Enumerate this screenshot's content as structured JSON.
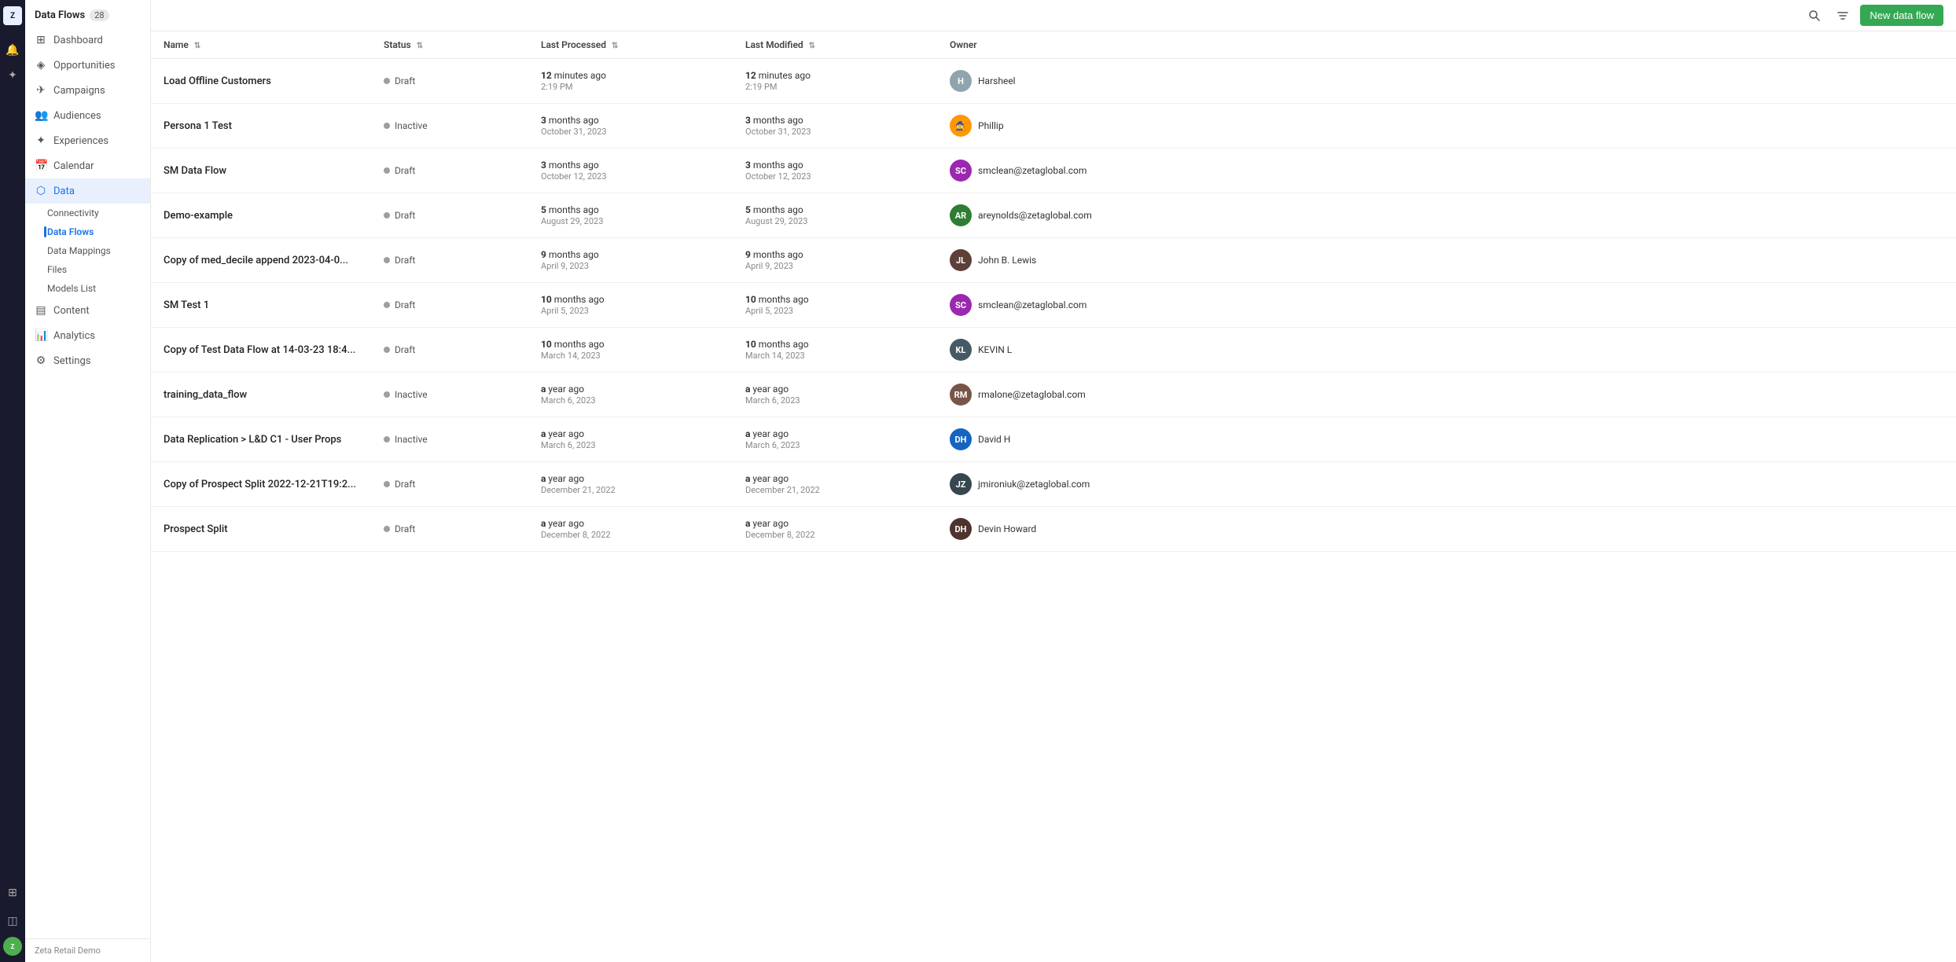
{
  "app": {
    "title": "Data Flows",
    "count": "28",
    "new_button": "New data flow",
    "org": "Zeta Retail Demo"
  },
  "iconbar": {
    "zeta_label": "ZETA"
  },
  "sidebar": {
    "items": [
      {
        "id": "dashboard",
        "label": "Dashboard",
        "icon": "⊞"
      },
      {
        "id": "opportunities",
        "label": "Opportunities",
        "icon": "◈"
      },
      {
        "id": "campaigns",
        "label": "Campaigns",
        "icon": "✈"
      },
      {
        "id": "audiences",
        "label": "Audiences",
        "icon": "👥"
      },
      {
        "id": "experiences",
        "label": "Experiences",
        "icon": "✦"
      },
      {
        "id": "calendar",
        "label": "Calendar",
        "icon": "📅"
      },
      {
        "id": "data",
        "label": "Data",
        "icon": "⬡",
        "active": true
      },
      {
        "id": "content",
        "label": "Content",
        "icon": "▤"
      },
      {
        "id": "analytics",
        "label": "Analytics",
        "icon": "📊"
      },
      {
        "id": "settings",
        "label": "Settings",
        "icon": "⚙"
      }
    ],
    "data_sub": [
      {
        "id": "connectivity",
        "label": "Connectivity"
      },
      {
        "id": "dataflows",
        "label": "Data Flows",
        "active": true
      },
      {
        "id": "datamappings",
        "label": "Data Mappings"
      },
      {
        "id": "files",
        "label": "Files"
      },
      {
        "id": "modelslist",
        "label": "Models List"
      }
    ]
  },
  "table": {
    "columns": [
      {
        "id": "name",
        "label": "Name"
      },
      {
        "id": "status",
        "label": "Status"
      },
      {
        "id": "last_processed",
        "label": "Last Processed"
      },
      {
        "id": "last_modified",
        "label": "Last Modified"
      },
      {
        "id": "owner",
        "label": "Owner"
      }
    ],
    "rows": [
      {
        "name": "Load Offline Customers",
        "status": "Draft",
        "status_type": "draft",
        "processed_ago": "12 minutes ago",
        "processed_date": "2:19 PM",
        "modified_ago": "12 minutes ago",
        "modified_date": "2:19 PM",
        "owner_name": "Harsheel",
        "owner_initials": "H",
        "owner_color": "#90a4ae"
      },
      {
        "name": "Persona 1 Test",
        "status": "Inactive",
        "status_type": "inactive",
        "processed_ago": "3 months ago",
        "processed_date": "October 31, 2023",
        "modified_ago": "3 months ago",
        "modified_date": "October 31, 2023",
        "owner_name": "Phillip",
        "owner_initials": "🧙",
        "owner_color": "#ff9800",
        "is_emoji": true
      },
      {
        "name": "SM Data Flow",
        "status": "Draft",
        "status_type": "draft",
        "processed_ago": "3 months ago",
        "processed_date": "October 12, 2023",
        "modified_ago": "3 months ago",
        "modified_date": "October 12, 2023",
        "owner_name": "smclean@zetaglobal.com",
        "owner_initials": "SC",
        "owner_color": "#9c27b0",
        "has_photo": true,
        "photo_bg": "#ce93d8"
      },
      {
        "name": "Demo-example",
        "status": "Draft",
        "status_type": "draft",
        "processed_ago": "5 months ago",
        "processed_date": "August 29, 2023",
        "modified_ago": "5 months ago",
        "modified_date": "August 29, 2023",
        "owner_name": "areynolds@zetaglobal.com",
        "owner_initials": "AR",
        "owner_color": "#2e7d32",
        "owner_bg": "#1b5e20"
      },
      {
        "name": "Copy of med_decile append 2023-04-0...",
        "status": "Draft",
        "status_type": "draft",
        "processed_ago": "9 months ago",
        "processed_date": "April 9, 2023",
        "modified_ago": "9 months ago",
        "modified_date": "April 9, 2023",
        "owner_name": "John B. Lewis",
        "owner_initials": "JL",
        "owner_color": "#5d4037",
        "has_photo": true,
        "photo_bg": "#a1887f"
      },
      {
        "name": "SM Test 1",
        "status": "Draft",
        "status_type": "draft",
        "processed_ago": "10 months ago",
        "processed_date": "April 5, 2023",
        "modified_ago": "10 months ago",
        "modified_date": "April 5, 2023",
        "owner_name": "smclean@zetaglobal.com",
        "owner_initials": "SC",
        "owner_color": "#9c27b0",
        "has_photo": true,
        "photo_bg": "#ce93d8"
      },
      {
        "name": "Copy of Test Data Flow at 14-03-23 18:4...",
        "status": "Draft",
        "status_type": "draft",
        "processed_ago": "10 months ago",
        "processed_date": "March 14, 2023",
        "modified_ago": "10 months ago",
        "modified_date": "March 14, 2023",
        "owner_name": "KEVIN L",
        "owner_initials": "KL",
        "owner_color": "#455a64"
      },
      {
        "name": "training_data_flow",
        "status": "Inactive",
        "status_type": "inactive",
        "processed_ago": "a year ago",
        "processed_date": "March 6, 2023",
        "modified_ago": "a year ago",
        "modified_date": "March 6, 2023",
        "owner_name": "rmalone@zetaglobal.com",
        "owner_initials": "RM",
        "owner_color": "#795548",
        "has_photo": true,
        "photo_bg": "#bcaaa4"
      },
      {
        "name": "Data Replication > L&D C1 - User Props",
        "status": "Inactive",
        "status_type": "inactive",
        "processed_ago": "a year ago",
        "processed_date": "March 6, 2023",
        "modified_ago": "a year ago",
        "modified_date": "March 6, 2023",
        "owner_name": "David H",
        "owner_initials": "DH",
        "owner_color": "#1565c0",
        "has_photo": true,
        "photo_bg": "#90caf9"
      },
      {
        "name": "Copy of Prospect Split 2022-12-21T19:2...",
        "status": "Draft",
        "status_type": "draft",
        "processed_ago": "a year ago",
        "processed_date": "December 21, 2022",
        "modified_ago": "a year ago",
        "modified_date": "December 21, 2022",
        "owner_name": "jmironiuk@zetaglobal.com",
        "owner_initials": "JZ",
        "owner_color": "#37474f"
      },
      {
        "name": "Prospect Split",
        "status": "Draft",
        "status_type": "draft",
        "processed_ago": "a year ago",
        "processed_date": "December 8, 2022",
        "modified_ago": "a year ago",
        "modified_date": "December 8, 2022",
        "owner_name": "Devin Howard",
        "owner_initials": "DH",
        "owner_color": "#4e342e",
        "has_photo": true,
        "photo_bg": "#a1887f"
      }
    ]
  }
}
